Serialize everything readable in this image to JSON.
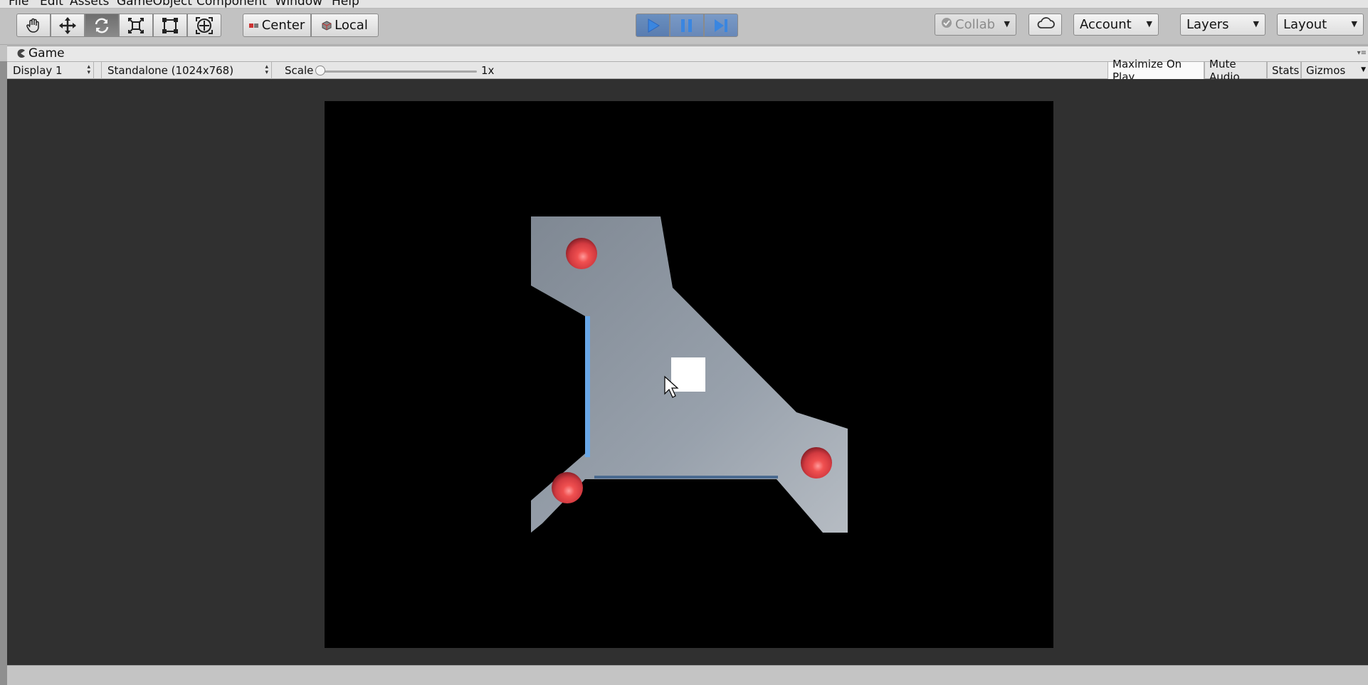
{
  "menu": [
    "File",
    "Edit",
    "Assets",
    "GameObject",
    "Component",
    "Window",
    "Help"
  ],
  "toolbar": {
    "tools": [
      "hand-tool",
      "move-tool",
      "rotate-tool",
      "scale-tool",
      "rect-tool",
      "transform-tool"
    ],
    "active_tool": "rotate-tool",
    "pivot_center_label": "Center",
    "pivot_local_label": "Local",
    "collab_label": "Collab",
    "account_label": "Account",
    "layers_label": "Layers",
    "layout_label": "Layout",
    "play_active": true
  },
  "panel": {
    "tab_label": "Game"
  },
  "controls": {
    "display": "Display 1",
    "resolution": "Standalone (1024x768)",
    "scale_label": "Scale",
    "scale_value": "1x",
    "maximize_on_play": "Maximize On Play",
    "mute_audio": "Mute Audio",
    "stats": "Stats",
    "gizmos": "Gizmos"
  },
  "colors": {
    "play_blue": "#3a86e0",
    "floor_grey": "#8f98a4",
    "sphere_red": "#e0404a",
    "wall_blue": "#6aa8e8",
    "viewport_bg": "#000000",
    "editor_bg": "#303030"
  }
}
